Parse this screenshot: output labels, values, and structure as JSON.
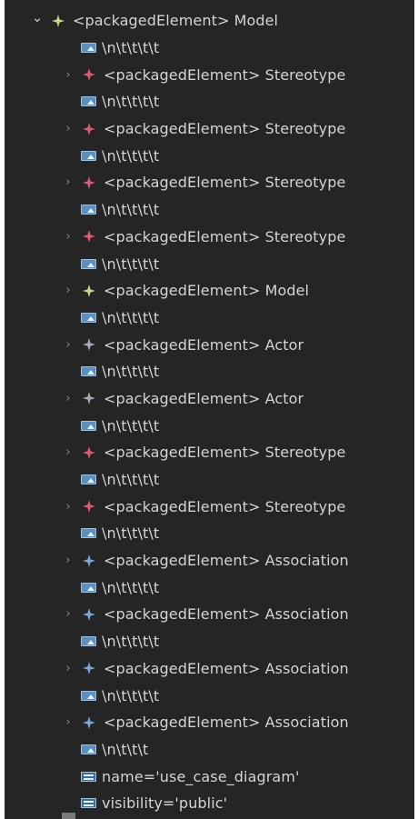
{
  "tree": {
    "root": {
      "tag": "<packagedElement>",
      "name": "Model",
      "expanded": true,
      "icon": "model-icon",
      "icon_color": "#c6d68a"
    },
    "text_value": "\\n\\t\\t\\t\\t",
    "text_value_last": "\\n\\t\\t\\t",
    "children": [
      {
        "tag": "<packagedElement>",
        "name": "Stereotype",
        "icon": "stereotype-icon",
        "icon_color": "#e0587a"
      },
      {
        "tag": "<packagedElement>",
        "name": "Stereotype",
        "icon": "stereotype-icon",
        "icon_color": "#e0587a"
      },
      {
        "tag": "<packagedElement>",
        "name": "Stereotype",
        "icon": "stereotype-icon",
        "icon_color": "#e0587a"
      },
      {
        "tag": "<packagedElement>",
        "name": "Stereotype",
        "icon": "stereotype-icon",
        "icon_color": "#e0587a"
      },
      {
        "tag": "<packagedElement>",
        "name": "Model",
        "icon": "model-icon",
        "icon_color": "#c6d68a"
      },
      {
        "tag": "<packagedElement>",
        "name": "Actor",
        "icon": "actor-icon",
        "icon_color": "#a8a8b8"
      },
      {
        "tag": "<packagedElement>",
        "name": "Actor",
        "icon": "actor-icon",
        "icon_color": "#a8a8b8"
      },
      {
        "tag": "<packagedElement>",
        "name": "Stereotype",
        "icon": "stereotype-icon",
        "icon_color": "#e0587a"
      },
      {
        "tag": "<packagedElement>",
        "name": "Stereotype",
        "icon": "stereotype-icon",
        "icon_color": "#e0587a"
      },
      {
        "tag": "<packagedElement>",
        "name": "Association",
        "icon": "association-icon",
        "icon_color": "#7aa6d8"
      },
      {
        "tag": "<packagedElement>",
        "name": "Association",
        "icon": "association-icon",
        "icon_color": "#7aa6d8"
      },
      {
        "tag": "<packagedElement>",
        "name": "Association",
        "icon": "association-icon",
        "icon_color": "#7aa6d8"
      },
      {
        "tag": "<packagedElement>",
        "name": "Association",
        "icon": "association-icon",
        "icon_color": "#7aa6d8"
      }
    ],
    "attributes": [
      {
        "text": "name='use_case_diagram'"
      },
      {
        "text": "visibility='public'"
      }
    ]
  }
}
